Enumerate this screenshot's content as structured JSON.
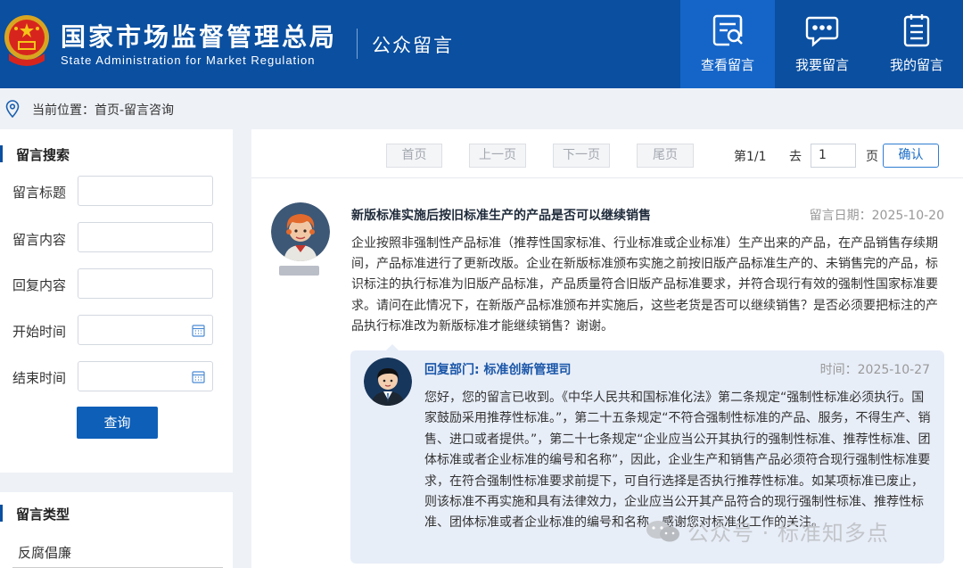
{
  "header": {
    "org_cn": "国家市场监督管理总局",
    "org_en": "State Administration for Market Regulation",
    "portal": "公众留言",
    "nav": [
      {
        "label": "查看留言",
        "icon": "view-messages-icon",
        "active": true
      },
      {
        "label": "我要留言",
        "icon": "chat-icon",
        "active": false
      },
      {
        "label": "我的留言",
        "icon": "list-icon",
        "active": false
      }
    ]
  },
  "breadcrumb": {
    "text": "当前位置：首页-留言咨询"
  },
  "search": {
    "title": "留言搜索",
    "fields": [
      {
        "label": "留言标题",
        "value": ""
      },
      {
        "label": "留言内容",
        "value": ""
      },
      {
        "label": "回复内容",
        "value": ""
      },
      {
        "label": "开始时间",
        "value": ""
      },
      {
        "label": "结束时间",
        "value": ""
      }
    ],
    "submit": "查询"
  },
  "types": {
    "title": "留言类型",
    "items": [
      "反腐倡廉"
    ]
  },
  "pager": {
    "first": "首页",
    "prev": "上一页",
    "next": "下一页",
    "last": "尾页",
    "page_info": "第1/1",
    "go_label": "去",
    "page_value": "1",
    "page_unit": "页",
    "confirm": "确认"
  },
  "message": {
    "title": "新版标准实施后按旧标准生产的产品是否可以继续销售",
    "date": "留言日期：2025-10-20",
    "body": "企业按照非强制性产品标准（推荐性国家标准、行业标准或企业标准）生产出来的产品，在产品销售存续期间，产品标准进行了更新改版。企业在新版标准颁布实施之前按旧版产品标准生产的、未销售完的产品，标识标注的执行标准为旧版产品标准，产品质量符合旧版产品标准要求，并符合现行有效的强制性国家标准要求。请问在此情况下，在新版产品标准颁布并实施后，这些老货是否可以继续销售？是否必须要把标注的产品执行标准改为新版标准才能继续销售？谢谢。"
  },
  "reply": {
    "dept": "回复部门: 标准创新管理司",
    "date": "时间：2025-10-27",
    "body": "您好，您的留言已收到。《中华人民共和国标准化法》第二条规定“强制性标准必须执行。国家鼓励采用推荐性标准。”，第二十五条规定“不符合强制性标准的产品、服务，不得生产、销售、进口或者提供。”，第二十七条规定“企业应当公开其执行的强制性标准、推荐性标准、团体标准或者企业标准的编号和名称”，因此，企业生产和销售产品必须符合现行强制性标准要求，在符合强制性标准要求前提下，可自行选择是否执行推荐性标准。如某项标准已废止，则该标准不再实施和具有法律效力，企业应当公开其产品符合的现行强制性标准、推荐性标准、团体标准或者企业标准的编号和名称。感谢您对标准化工作的关注。"
  },
  "watermark": {
    "text": "公众号 · 标准知多点"
  },
  "colors": {
    "brand": "#0a4fa0",
    "active_nav": "#1565c8",
    "reply_bg": "#e8eef8",
    "accent_text": "#1a56a8"
  }
}
